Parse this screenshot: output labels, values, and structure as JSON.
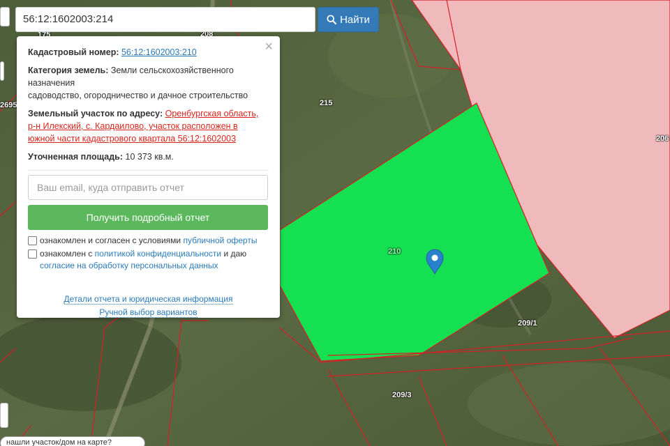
{
  "search": {
    "value": "56:12:1602003:214",
    "button_label": "Найти"
  },
  "popup": {
    "cadastral_label": "Кадастровый номер:",
    "cadastral_value": "56:12:1602003:210",
    "category_label": "Категория земель:",
    "category_value_line1": "Земли сельскохозяйственного",
    "category_value_line2": "назначения",
    "category_value_line3": "садоводство, огородничество и дачное строительство",
    "address_label": "Земельный участок по адресу:",
    "address_value_part1": "Оренбургская область,",
    "address_value_part2": "р-н Илекский, с. Кардаилово, участок расположен в",
    "address_value_part3": "южной части кадастрового квартала 56:12:1602003",
    "area_label": "Уточненная площадь:",
    "area_value": "10 373 кв.м.",
    "email_placeholder": "Ваш email, куда отправить отчет",
    "report_button": "Получить подробный отчет",
    "check1_text": "ознакомлен и согласен с условиями",
    "check1_link": "публичной оферты",
    "check2_text_a": "ознакомлен с",
    "check2_link_a": "политикой конфиденциальности",
    "check2_text_b": "и даю",
    "check2_link_b": "согласие на обработку персональных данных",
    "details_link": "Детали отчета и юридическая информация",
    "manual_link": "Ручной выбор вариантов",
    "close": "×"
  },
  "map_labels": {
    "l175": "175",
    "l208": "208",
    "l2695": "2695",
    "l215": "215",
    "l206": "206",
    "l210": "210",
    "l209_1": "209/1",
    "l209_3": "209/3"
  },
  "bottom": {
    "text": "нашли участок/дом на карте?"
  },
  "colors": {
    "selected_parcel": "#14e052",
    "pink_zone": "#f0b9bb",
    "boundary": "#d61f26",
    "search_button": "#337ab7",
    "report_button": "#5cb85c"
  },
  "icons": {
    "search_button": "search-icon",
    "marker": "map-marker-icon",
    "close": "close-icon"
  }
}
